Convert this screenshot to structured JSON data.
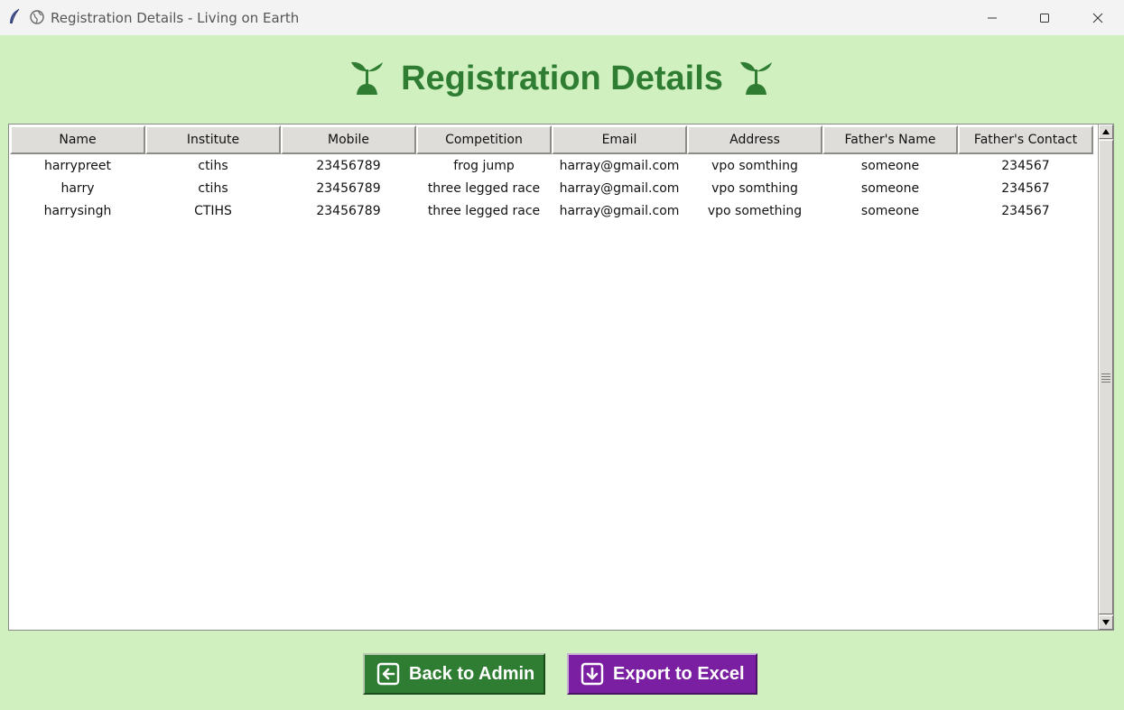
{
  "window": {
    "title": "Registration Details - Living on Earth"
  },
  "heading": {
    "title": "Registration Details"
  },
  "table": {
    "columns": [
      "Name",
      "Institute",
      "Mobile",
      "Competition",
      "Email",
      "Address",
      "Father's Name",
      "Father's Contact"
    ],
    "rows": [
      [
        "harrypreet",
        "ctihs",
        "23456789",
        "frog jump",
        "harray@gmail.com",
        "vpo somthing",
        "someone",
        "234567"
      ],
      [
        "harry",
        "ctihs",
        "23456789",
        "three legged race",
        "harray@gmail.com",
        "vpo somthing",
        "someone",
        "234567"
      ],
      [
        "harrysingh",
        "CTIHS",
        "23456789",
        "three legged race",
        "harray@gmail.com",
        "vpo something",
        "someone",
        "234567"
      ]
    ]
  },
  "buttons": {
    "back_label": "Back to Admin",
    "export_label": "Export to Excel"
  },
  "colors": {
    "background": "#d0f0c0",
    "heading": "#2e7d32",
    "back_button": "#2e7d32",
    "export_button": "#7b1fa2"
  }
}
